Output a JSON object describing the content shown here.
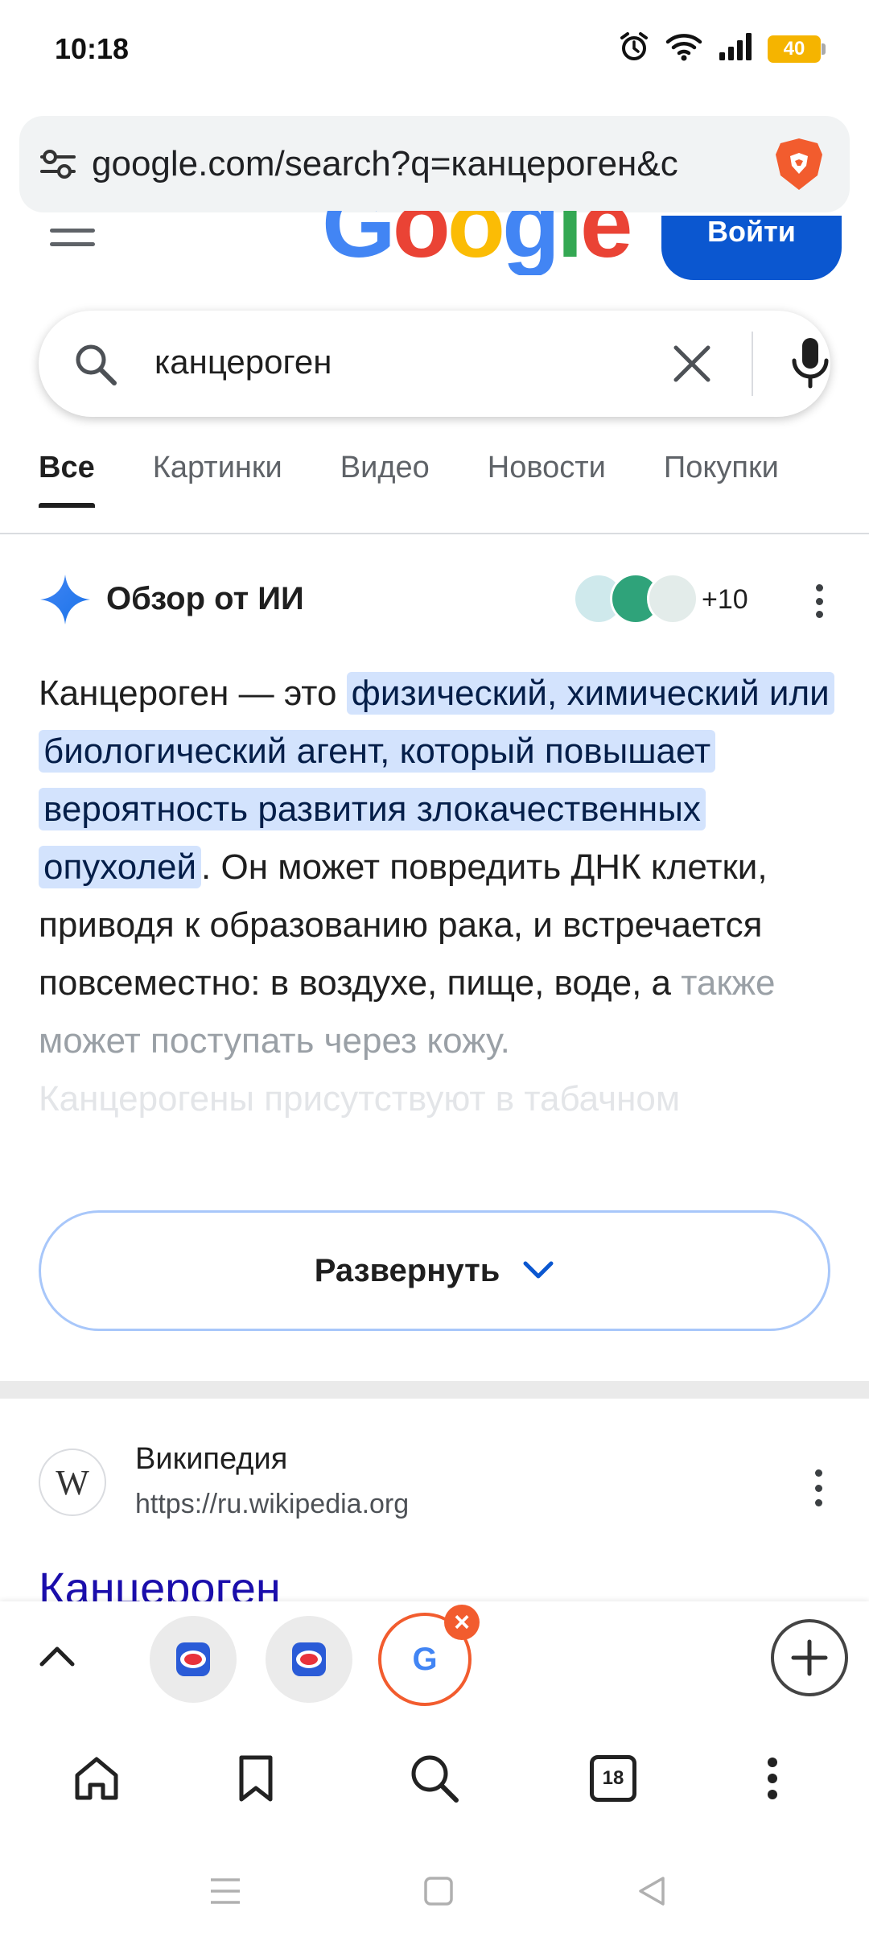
{
  "status_bar": {
    "time": "10:18",
    "battery": "40",
    "icons": [
      "alarm-icon",
      "wifi-icon",
      "signal-icon",
      "battery-icon"
    ]
  },
  "url_bar": {
    "url": "google.com/search?q=канцероген&c"
  },
  "google_header": {
    "logo_text": "Google",
    "signin_label": "Войти"
  },
  "search": {
    "query": "канцероген"
  },
  "tabs": [
    {
      "label": "Все",
      "active": true
    },
    {
      "label": "Картинки"
    },
    {
      "label": "Видео"
    },
    {
      "label": "Новости"
    },
    {
      "label": "Покупки"
    }
  ],
  "ai_overview": {
    "title": "Обзор от ИИ",
    "sources_more": "+10",
    "text_intro": "Канцероген — это ",
    "text_highlight": "физический, химический или биологический агент, который повышает вероятность развития злокачественных опухолей",
    "text_main": ". Он может повредить ДНК клетки, приводя к образованию рака, и встречается повсеместно: в воздухе, пище, воде, а ",
    "text_fade1": "также может поступать через кожу.",
    "text_fade2": "Канцерогены присутствуют в табачном",
    "expand_label": "Развернуть"
  },
  "result": {
    "site_name": "Википедия",
    "url": "https://ru.wikipedia.org",
    "title": "Канцероген",
    "logo_letter": "W"
  },
  "tab_switcher": {
    "close_glyph": "×",
    "google_letter": "G"
  },
  "bottom_nav": {
    "tab_count": "18"
  },
  "colors": {
    "accent": "#0b57d0",
    "highlight": "#d3e3fd",
    "link": "#1a0dab",
    "brave": "#f25c2e"
  }
}
